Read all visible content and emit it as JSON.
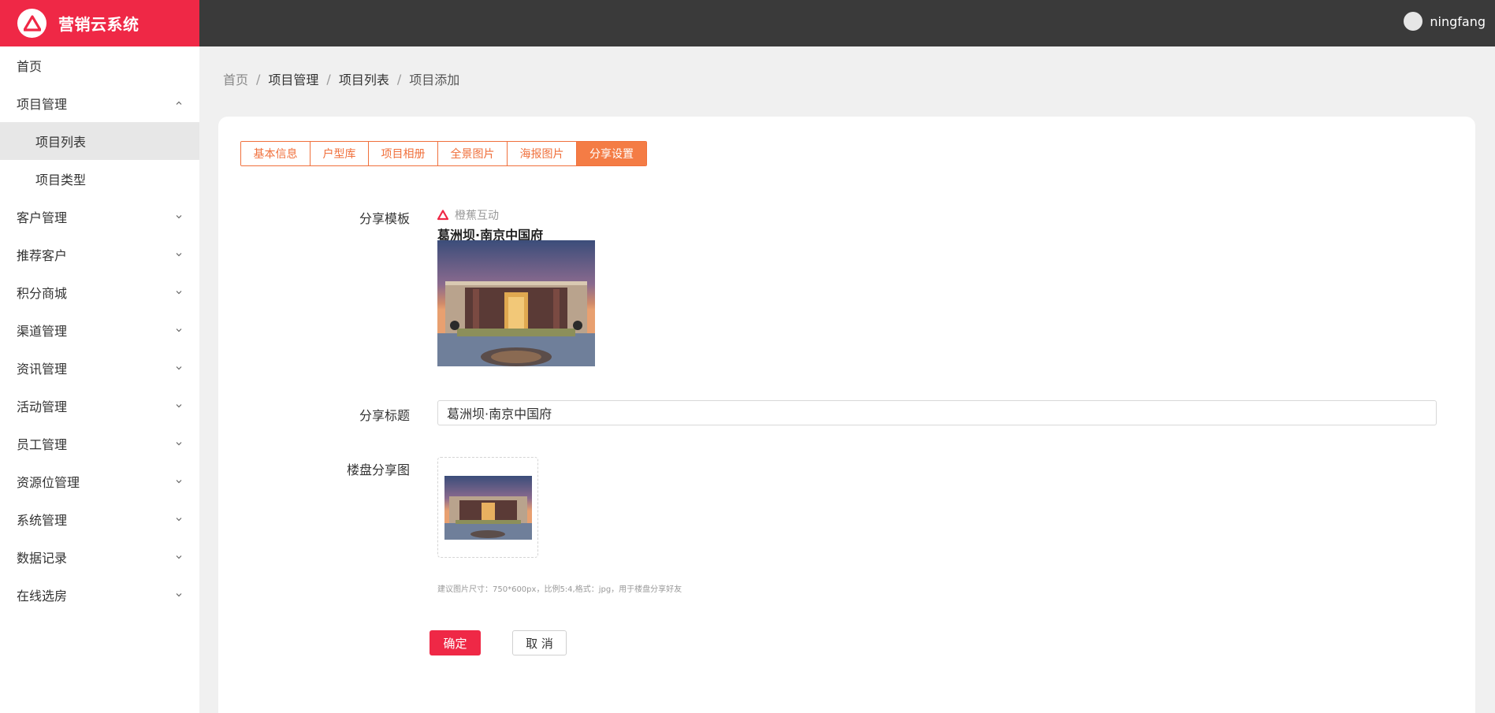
{
  "app": {
    "title": "营销云系统"
  },
  "user": {
    "name": "ningfang"
  },
  "sidebar": {
    "items": [
      {
        "label": "首页"
      },
      {
        "label": "项目管理",
        "sub": [
          {
            "label": "项目列表",
            "active": true
          },
          {
            "label": "项目类型"
          }
        ]
      },
      {
        "label": "客户管理"
      },
      {
        "label": "推荐客户"
      },
      {
        "label": "积分商城"
      },
      {
        "label": "渠道管理"
      },
      {
        "label": "资讯管理"
      },
      {
        "label": "活动管理"
      },
      {
        "label": "员工管理"
      },
      {
        "label": "资源位管理"
      },
      {
        "label": "系统管理"
      },
      {
        "label": "数据记录"
      },
      {
        "label": "在线选房"
      }
    ]
  },
  "breadcrumb": {
    "home": "首页",
    "level1": "项目管理",
    "level2": "项目列表",
    "current": "项目添加",
    "separator": "/"
  },
  "tabs": [
    {
      "label": "基本信息"
    },
    {
      "label": "户型库"
    },
    {
      "label": "项目相册"
    },
    {
      "label": "全景图片"
    },
    {
      "label": "海报图片"
    },
    {
      "label": "分享设置",
      "active": true
    }
  ],
  "form": {
    "template_label": "分享模板",
    "template": {
      "brand": "橙蕉互动",
      "title": "葛洲坝·南京中国府"
    },
    "title_label": "分享标题",
    "title_value": "葛洲坝·南京中国府",
    "image_label": "楼盘分享图",
    "hint": "建议图片尺寸：750*600px，比例5:4,格式：jpg，用于楼盘分享好友",
    "ok_label": "确定",
    "cancel_label": "取 消"
  },
  "colors": {
    "brand_red": "#ef2846",
    "topbar": "#3a3a3a",
    "tab_orange": "#f0703c"
  }
}
